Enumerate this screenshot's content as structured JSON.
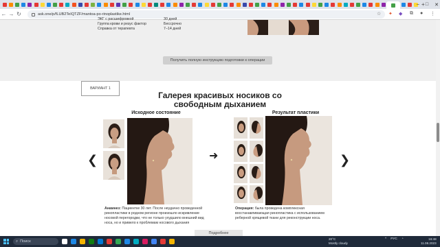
{
  "browser": {
    "url": "ask.one/p/fLUB2TeIQTZF/mantoa-po-rinoplastike.html",
    "tab_favicon_colors": [
      "#e53935",
      "#fb8c00",
      "#43a047",
      "#1e88e5",
      "#8e24aa",
      "#e53935",
      "#fdd835",
      "#1e88e5",
      "#43a047",
      "#e53935",
      "#00acc1",
      "#f4511e",
      "#3949ab",
      "#e53935",
      "#7cb342",
      "#1e88e5",
      "#fb8c00",
      "#e53935",
      "#5e35b1",
      "#43a047",
      "#e53935",
      "#1e88e5",
      "#fdd835",
      "#e53935",
      "#00897b",
      "#e53935",
      "#1e88e5",
      "#fb8c00",
      "#8e24aa",
      "#43a047",
      "#e53935",
      "#1e88e5",
      "#fdd835",
      "#e53935",
      "#43a047",
      "#1e88e5",
      "#e53935",
      "#fb8c00",
      "#3949ab",
      "#e53935",
      "#43a047",
      "#1e88e5",
      "#e53935",
      "#fb8c00",
      "#8e24aa",
      "#43a047",
      "#e53935",
      "#1e88e5",
      "#e53935",
      "#fdd835",
      "#43a047",
      "#1e88e5",
      "#e53935",
      "#fb8c00",
      "#00acc1",
      "#e53935",
      "#43a047",
      "#1e88e5",
      "#e53935",
      "#fb8c00",
      "#8e24aa",
      "#43a047",
      "#1e88e5",
      "#e53935",
      "#fdd835"
    ],
    "new_tab": "+",
    "window_controls": [
      "–",
      "□",
      "✕"
    ]
  },
  "prep_table": {
    "rows": [
      {
        "label": "ЭКГ с расшифровкой",
        "value": "30 дней"
      },
      {
        "label": "Группа крови и резус фактор",
        "value": "Бессрочно"
      },
      {
        "label": "Справка от терапевта",
        "value": "7–14 дней"
      }
    ]
  },
  "instruction_button": "Получить полную инструкцию подготовки к операции",
  "variant_tab": "ВАРИАНТ 1",
  "gallery": {
    "title_line1": "Галерея красивых носиков со",
    "title_line2": "свободным дыханием",
    "before_title": "Исходное состояние",
    "after_title": "Результат пластики",
    "anamnesis_label": "Анамнез:",
    "anamnesis_text": "Пациентке 30 лет. После неудачно проведенной ринопластики в родном регионе произошло искривление носовой перегородки, что не только ухудшило внешний вид носа, но и привело к проблемам носового дыхания",
    "operation_label": "Операция:",
    "operation_text": "была проведена комплексная восстанавливающая ринопластика с использованием реберной хрящевой ткани для реконструкции носа.",
    "more_button": "Подробнее"
  },
  "taskbar": {
    "search_placeholder": "Поиск",
    "weather_temp": "20°C",
    "weather_desc": "Mostly cloudy",
    "lang": "РУС",
    "time": "16:48",
    "date": "11.08.2023",
    "app_icon_colors": [
      "#ffffff",
      "#1e88e5",
      "#f4b400",
      "#107c10",
      "#0078d4",
      "#e53935",
      "#34a853",
      "#1e88e5",
      "#00acc1",
      "#d81b60",
      "#4285f4",
      "#e53935",
      "#f4b400"
    ]
  }
}
